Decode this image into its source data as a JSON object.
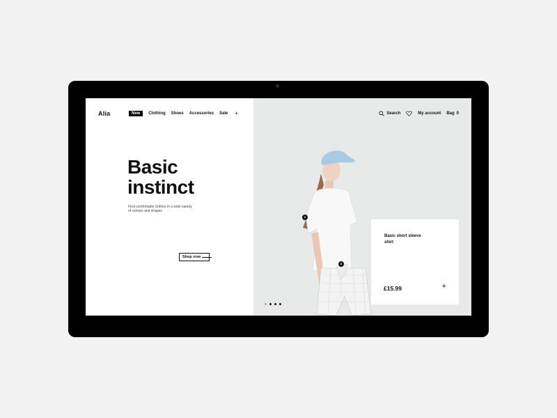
{
  "brand": {
    "logo": "Alia"
  },
  "nav": {
    "items": [
      {
        "label": "New",
        "active": true
      },
      {
        "label": "Clothing"
      },
      {
        "label": "Shoes"
      },
      {
        "label": "Accessories"
      },
      {
        "label": "Sale"
      }
    ],
    "more_icon": "plus-icon"
  },
  "header_actions": {
    "search_label": "Search",
    "account_label": "My account",
    "bag_label": "Bag",
    "bag_count": "0"
  },
  "hero": {
    "headline_line1": "Basic",
    "headline_line2": "instinct",
    "subtext": "Find comfortable clothes in a wide variety of colours and shapes",
    "cta_label": "Shop now"
  },
  "hotspots": [
    {
      "label": "1"
    },
    {
      "label": "2"
    }
  ],
  "slider": {
    "count": 4,
    "active_index": 1
  },
  "product_card": {
    "title": "Basic short sleeve shirt",
    "price": "£15.99",
    "add_icon": "plus-icon"
  },
  "colors": {
    "accent": "#000000",
    "panel_bg": "#e8eaea",
    "page_bg": "#f2f2f2"
  }
}
